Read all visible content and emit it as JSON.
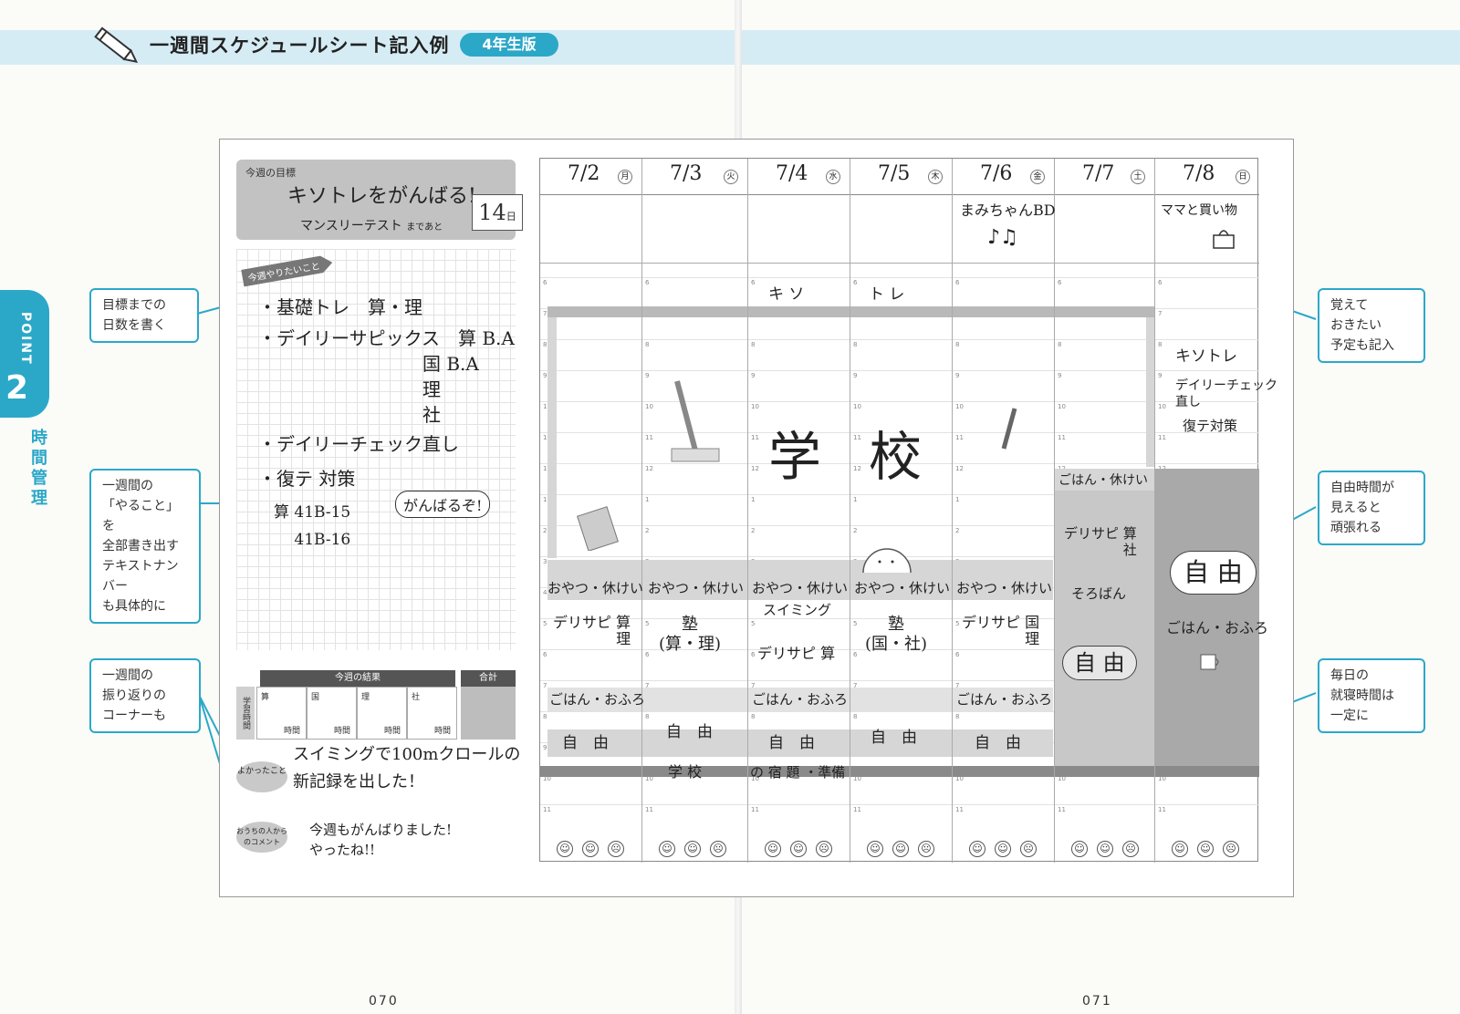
{
  "header": {
    "title": "一週間スケジュールシート記入例",
    "grade": "4年生版"
  },
  "side_tab": {
    "point": "POINT",
    "number": "2",
    "section": "時間管理"
  },
  "callouts": {
    "days_left": "目標までの\n日数を書く",
    "write_all": "一週間の\n「やること」を\n全部書き出す\nテキストナンバー\nも具体的に",
    "reflection": "一週間の\n振り返りの\nコーナーも",
    "plans": "覚えて\nおきたい\n予定も記入",
    "free_time": "自由時間が\n見えると\n頑張れる",
    "bedtime": "毎日の\n就寝時間は\n一定に"
  },
  "goal": {
    "label": "今週の目標",
    "text": "キソトレをがんばる!",
    "sub": "マンスリーテスト",
    "until": "まであと",
    "days": "14",
    "day_unit": "日"
  },
  "todo": {
    "tag": "今週やりたいこと",
    "items": [
      "・基礎トレ　算・理",
      "・デイリーサピックス　算 B.A\n　　　　　　　　　国 B.A\n　　　　　　　　　理\n　　　　　　　　　社",
      "・デイリーチェック直し",
      "・復テ 対策",
      "　算 41B-15\n　　 41B-16"
    ],
    "cheer": "がんばるぞ!"
  },
  "results": {
    "header": "今週の結果",
    "total": "合計",
    "side": "学習時間",
    "subjects": [
      "算",
      "国",
      "理",
      "社"
    ],
    "unit": "時間"
  },
  "reflection": {
    "good_label": "よかったこと",
    "good_text": "スイミングで100mクロールの\n新記録を出した！",
    "family_label": "おうちの人からのコメント",
    "family_text": "今週もがんばりました!\nやったね!!"
  },
  "calendar": {
    "days": [
      {
        "date": "7/2",
        "wd": "月"
      },
      {
        "date": "7/3",
        "wd": "火"
      },
      {
        "date": "7/4",
        "wd": "水"
      },
      {
        "date": "7/5",
        "wd": "木"
      },
      {
        "date": "7/6",
        "wd": "金"
      },
      {
        "date": "7/7",
        "wd": "土"
      },
      {
        "date": "7/8",
        "wd": "日"
      }
    ],
    "hours": [
      "6",
      "7",
      "8",
      "9",
      "10",
      "11",
      "12",
      "1",
      "2",
      "3",
      "4",
      "5",
      "6",
      "7",
      "8",
      "9",
      "10",
      "11"
    ],
    "events": {
      "fri_event": "まみちゃんBD",
      "fri_note": "♪♫",
      "sun_event": "ママと買い物",
      "kiso": "キ ソ",
      "tore": "ト レ",
      "school": "学",
      "school2": "校",
      "snack": "おやつ・休けい",
      "sun_kiso": "キソトレ",
      "sun_check": "デイリーチェック\n直し",
      "sun_fukute": "復テ対策",
      "sat_meal": "ごはん・休けい",
      "sat_sapix": "デリサピ 算\n　　　　 社",
      "sat_soroban": "そろばん",
      "sat_free": "自 由",
      "sun_free": "自 由",
      "sun_meal": "ごはん・おふろ",
      "mon_sapix": "デリサピ 算\n　　　　 理",
      "tue_juku": "塾\n(算・理)",
      "wed_swim": "スイミング",
      "wed_sapix": "デリサピ 算",
      "thu_juku": "塾\n(国・社)",
      "fri_sapix": "デリサピ 国\n　　　　 理",
      "meal_bath": "ごはん・おふろ",
      "free": "自　由",
      "tue_school": "学 校",
      "wed_prep": "の 宿 題 ・準備"
    },
    "moods": [
      "☺",
      "☺",
      "☹"
    ]
  },
  "page_numbers": {
    "left": "070",
    "right": "071"
  }
}
